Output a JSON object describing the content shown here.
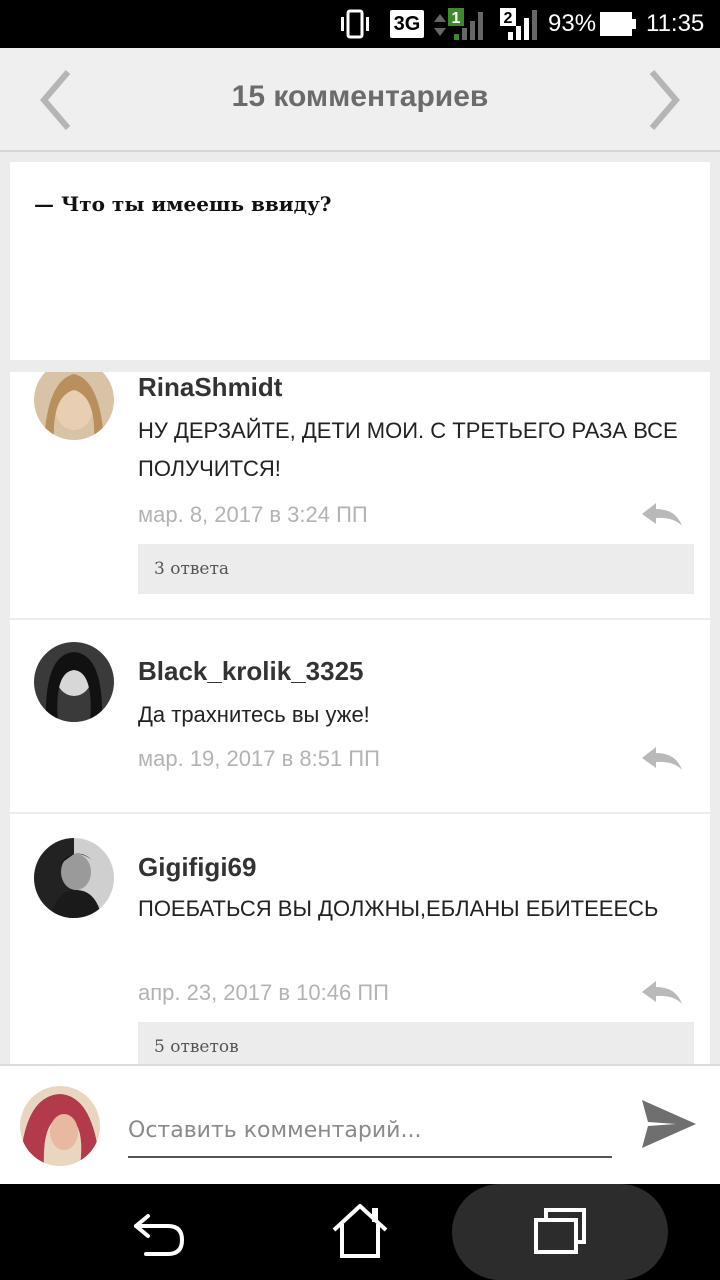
{
  "status_bar": {
    "network": "3G",
    "sim1": "1",
    "sim2": "2",
    "battery": "93%",
    "time": "11:35"
  },
  "header": {
    "title": "15 комментариев"
  },
  "story": {
    "text": "— Что ты имеешь ввиду?"
  },
  "comments": [
    {
      "author": "RinaShmidt",
      "text": "НУ ДЕРЗАЙТЕ,  ДЕТИ МОИ.  С ТРЕТЬЕГО РАЗА ВСЕ ПОЛУЧИТСЯ!",
      "date": "мар. 8, 2017 в 3:24 ПП",
      "replies": "3 ответа"
    },
    {
      "author": "Black_krolik_3325",
      "text": "Да трахнитесь вы уже!",
      "date": "мар. 19, 2017 в 8:51 ПП"
    },
    {
      "author": "Gigifigi69",
      "text": "ПОЕБАТЬСЯ ВЫ ДОЛЖНЫ,ЕБЛАНЫ ЕБИТЕЕЕСЬ",
      "date": "апр. 23, 2017 в 10:46 ПП",
      "replies": "5 ответов"
    }
  ],
  "compose": {
    "placeholder": "Оставить комментарий..."
  },
  "icons": {
    "prev": "chevron-left-icon",
    "next": "chevron-right-icon",
    "reply": "reply-icon",
    "send": "send-icon",
    "back": "back-icon",
    "home": "home-icon",
    "recents": "recents-icon"
  }
}
